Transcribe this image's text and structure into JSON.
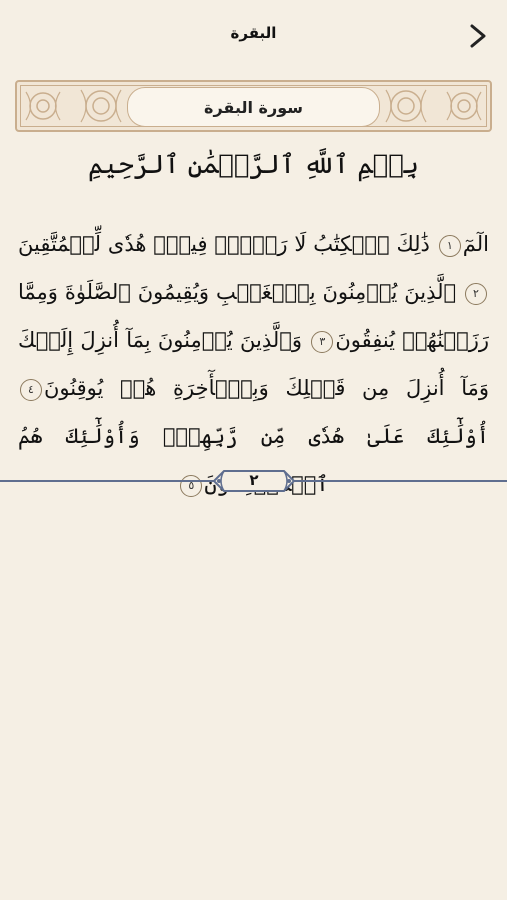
{
  "header": {
    "title": "البقرة"
  },
  "surah": {
    "name": "سورة البقرة"
  },
  "basmala": "بِسۡمِ ٱللَّهِ ٱلرَّحۡمَٰنِ ٱلرَّحِيمِ",
  "verses": [
    {
      "text": "الٓمٓ",
      "num": "١"
    },
    {
      "text": "ذَٰلِكَ ٱلۡكِتَٰبُ لَا رَيۡبَۛ فِيهِۛ هُدٗى لِّلۡمُتَّقِينَ",
      "num": "٢"
    },
    {
      "text": "ٱلَّذِينَ يُؤۡمِنُونَ بِٱلۡغَيۡبِ وَيُقِيمُونَ ٱلصَّلَوٰةَ وَمِمَّا رَزَقۡنَٰهُمۡ يُنفِقُونَ",
      "num": "٣"
    },
    {
      "text": "وَٱلَّذِينَ يُؤۡمِنُونَ بِمَآ أُنزِلَ إِلَيۡكَ وَمَآ أُنزِلَ مِن قَبۡلِكَ وَبِٱلۡأٓخِرَةِ هُمۡ يُوقِنُونَ",
      "num": "٤"
    },
    {
      "text": "أُوْلَٰٓئِكَ عَلَىٰ هُدٗى مِّن رَّبِّهِمۡۖ وَأُوْلَٰٓئِكَ هُمُ ٱلۡمُفۡلِحُونَ",
      "num": "٥"
    }
  ],
  "page": {
    "number": "٢"
  }
}
